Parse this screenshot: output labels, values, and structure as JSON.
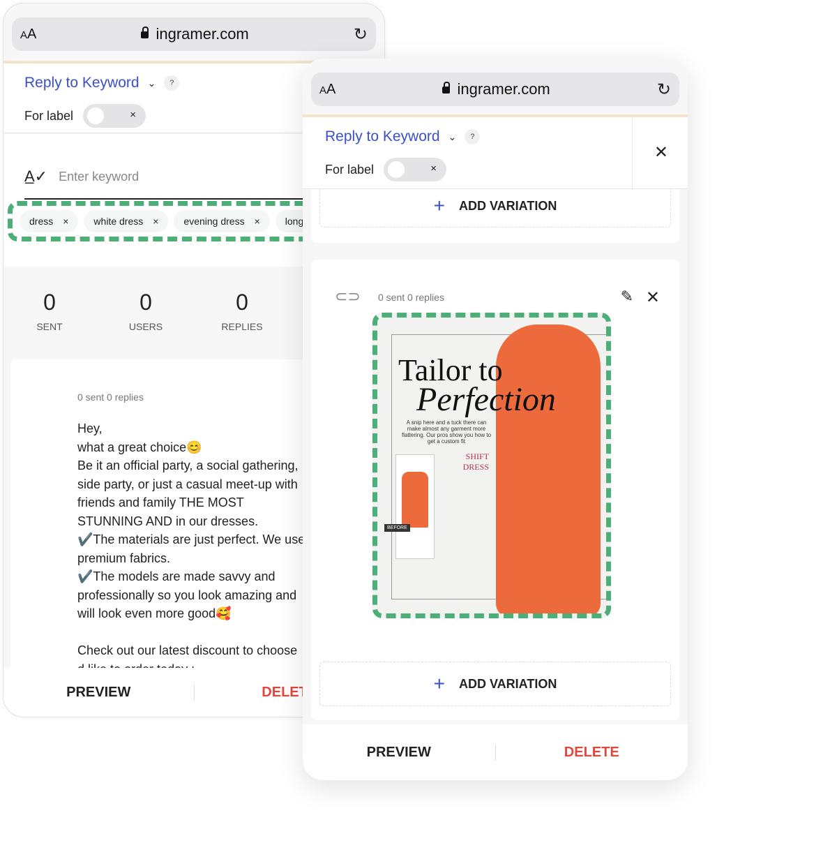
{
  "browser": {
    "aa_small": "A",
    "aa_large": "A",
    "url": "ingramer.com"
  },
  "header": {
    "title": "Reply to Keyword",
    "help": "?",
    "for_label": "For label",
    "toggle_x": "×",
    "close": "✕"
  },
  "keywords": {
    "placeholder": "Enter keyword",
    "chips": [
      "dress",
      "white dress",
      "evening dress",
      "long"
    ],
    "chip_remove": "×"
  },
  "stats": [
    {
      "value": "0",
      "label": "SENT"
    },
    {
      "value": "0",
      "label": "USERS"
    },
    {
      "value": "0",
      "label": "REPLIES"
    }
  ],
  "message": {
    "meta": "0 sent  0 replies",
    "text": "Hey,\nwhat a great choice😊\nBe it an official party, a social gathering, side party, or just a casual meet-up with friends and family THE MOST STUNNING AND in our dresses.\n✔️The materials are just perfect. We use premium fabrics.\n✔️The models are made savvy and professionally so you look amazing and will look even more good🥰\n\nCheck out our latest discount to choose d like to order today :"
  },
  "variation": {
    "meta": "0 sent  0 replies",
    "add_label": "ADD VARIATION",
    "image_text": {
      "title1": "Tailor to",
      "title2": "Perfection",
      "subtitle": "A snip here and a tuck there can make almost any garment more flattering. Our pros show you how to get a custom fit",
      "section": "SHIFT DRESS",
      "before": "BEFORE"
    }
  },
  "footer": {
    "preview": "PREVIEW",
    "delete": "DELETE"
  },
  "colors": {
    "accent": "#3a50c8",
    "delete": "#e0483e",
    "highlight": "#4caf78",
    "dress": "#ec6a3c"
  }
}
